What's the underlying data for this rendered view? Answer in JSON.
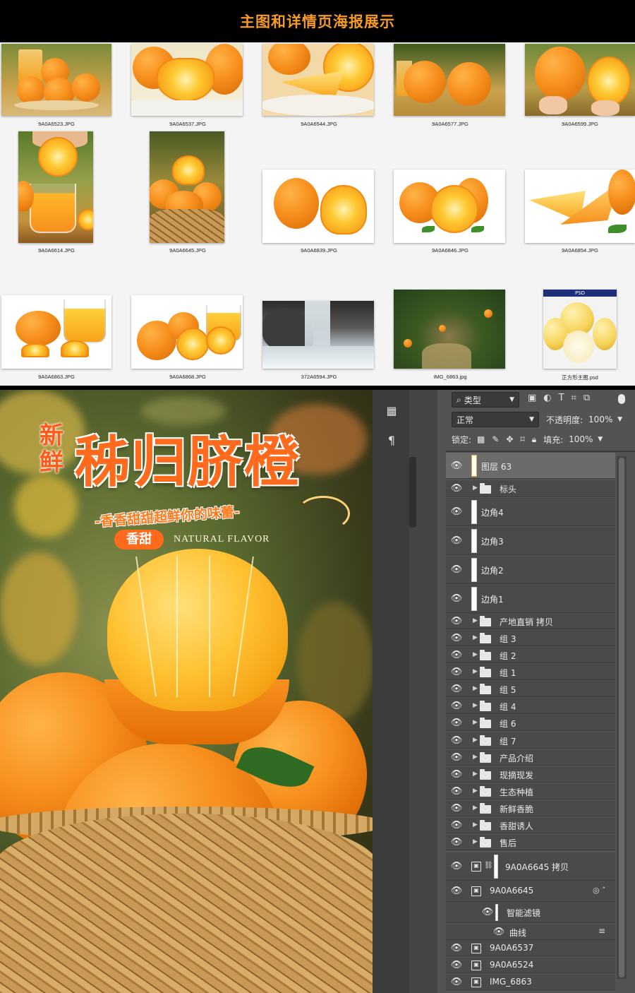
{
  "header": {
    "title": "主图和详情页海报展示"
  },
  "browser": {
    "files": [
      {
        "name": "9A0A6523.JPG"
      },
      {
        "name": "9A0A6537.JPG"
      },
      {
        "name": "9A0A6544.JPG"
      },
      {
        "name": "9A0A6577.JPG"
      },
      {
        "name": "9A0A6599.JPG"
      },
      {
        "name": "9A0A6614.JPG"
      },
      {
        "name": "9A0A6645.JPG"
      },
      {
        "name": "9A0A6839.JPG"
      },
      {
        "name": "9A0A6846.JPG"
      },
      {
        "name": "9A0A6854.JPG"
      },
      {
        "name": "9A0A6863.JPG"
      },
      {
        "name": "9A0A6868.JPG"
      },
      {
        "name": "372A6594.JPG"
      },
      {
        "name": "IMG_6863.jpg"
      },
      {
        "name": "正方形主图.psd",
        "tag": "PSD"
      }
    ]
  },
  "poster": {
    "title_small": "新鲜",
    "title": "秭归脐橙",
    "subtitle": "-香香甜甜超鲜你的味蕾-",
    "badge": "香甜",
    "english": "NATURAL FLAVOR"
  },
  "ps": {
    "filter_label": "类型",
    "blend_mode": "正常",
    "opacity_label": "不透明度:",
    "opacity_value": "100%",
    "lock_label": "锁定:",
    "fill_label": "填充:",
    "fill_value": "100%",
    "layers": [
      {
        "name": "图层 63",
        "kind": "pixel",
        "selected": true
      },
      {
        "name": "标头",
        "kind": "group"
      },
      {
        "name": "边角4",
        "kind": "pixel"
      },
      {
        "name": "边角3",
        "kind": "pixel"
      },
      {
        "name": "边角2",
        "kind": "pixel"
      },
      {
        "name": "边角1",
        "kind": "pixel"
      },
      {
        "name": "产地直销 拷贝",
        "kind": "group"
      },
      {
        "name": "组 3",
        "kind": "group"
      },
      {
        "name": "组 2",
        "kind": "group"
      },
      {
        "name": "组 1",
        "kind": "group"
      },
      {
        "name": "组 5",
        "kind": "group"
      },
      {
        "name": "组 4",
        "kind": "group"
      },
      {
        "name": "组 6",
        "kind": "group"
      },
      {
        "name": "组 7",
        "kind": "group"
      },
      {
        "name": "产品介绍",
        "kind": "group"
      },
      {
        "name": "现摘现发",
        "kind": "group"
      },
      {
        "name": "生态种植",
        "kind": "group"
      },
      {
        "name": "新鲜香脆",
        "kind": "group"
      },
      {
        "name": "香甜诱人",
        "kind": "group"
      },
      {
        "name": "售后",
        "kind": "group"
      },
      {
        "name": "9A0A6645 拷贝",
        "kind": "smart-masked"
      },
      {
        "name": "9A0A6645",
        "kind": "smart"
      },
      {
        "name": "智能滤镜",
        "kind": "filter"
      },
      {
        "name": "曲线",
        "kind": "curve"
      },
      {
        "name": "9A0A6537",
        "kind": "smart"
      },
      {
        "name": "9A0A6524",
        "kind": "smart"
      },
      {
        "name": "IMG_6863",
        "kind": "smart"
      }
    ]
  },
  "colors": {
    "accent": "#f59a23",
    "ps_bg": "#535353",
    "ps_row": "#4a4a4a",
    "ps_selected": "#6b6b6b"
  }
}
